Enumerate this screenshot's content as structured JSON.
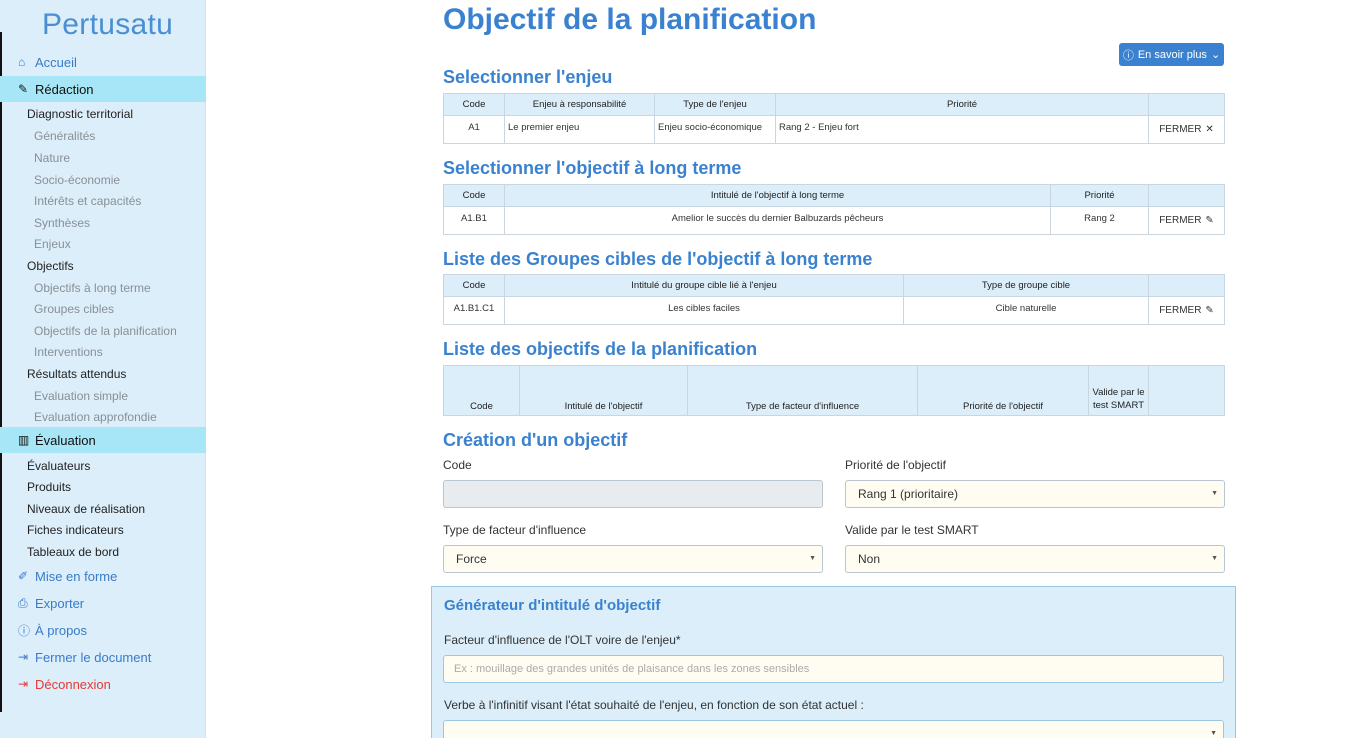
{
  "brand": "Pertusatu",
  "nav": {
    "accueil": "Accueil",
    "redaction": "Rédaction",
    "diagnostic": "Diagnostic territorial",
    "generalites": "Généralités",
    "nature": "Nature",
    "socio": "Socio-économie",
    "interets": "Intérêts et capacités",
    "syntheses": "Synthèses",
    "enjeux": "Enjeux",
    "objectifs": "Objectifs",
    "olt": "Objectifs à long terme",
    "groupes": "Groupes cibles",
    "obj_planif": "Objectifs de la planification",
    "interventions": "Interventions",
    "resultats": "Résultats attendus",
    "eval_simple": "Evaluation simple",
    "eval_appro": "Evaluation approfondie",
    "evaluation": "Évaluation",
    "evaluateurs": "Évaluateurs",
    "produits": "Produits",
    "niveaux": "Niveaux de réalisation",
    "fiches": "Fiches indicateurs",
    "tableaux": "Tableaux de bord",
    "mise_en_forme": "Mise en forme",
    "exporter": "Exporter",
    "apropos": "À propos",
    "fermer_doc": "Fermer le document",
    "deconnexion": "Déconnexion"
  },
  "page_title": "Objectif de la planification",
  "info_button": "En savoir plus",
  "sections": {
    "enjeu": "Selectionner l'enjeu",
    "olt": "Selectionner l'objectif à long terme",
    "groupes": "Liste des Groupes cibles de l'objectif à long terme",
    "objectifs": "Liste des objectifs de la planification",
    "creation": "Création d'un objectif"
  },
  "table_enjeu": {
    "headers": [
      "Code",
      "Enjeu à responsabilité",
      "Type de l'enjeu",
      "Priorité",
      ""
    ],
    "row": [
      "A1",
      "Le premier enjeu",
      "Enjeu socio-économique",
      "Rang 2 - Enjeu fort"
    ],
    "action": "FERMER"
  },
  "table_olt": {
    "headers": [
      "Code",
      "Intitulé de l'objectif à long terme",
      "Priorité",
      ""
    ],
    "row": [
      "A1.B1",
      "Amelior le succès du dernier Balbuzards pêcheurs",
      "Rang 2"
    ],
    "action": "FERMER"
  },
  "table_groupes": {
    "headers": [
      "Code",
      "Intitulé du groupe cible lié à l'enjeu",
      "Type de groupe cible",
      ""
    ],
    "row": [
      "A1.B1.C1",
      "Les cibles faciles",
      "Cible naturelle"
    ],
    "action": "FERMER"
  },
  "table_objectifs": {
    "headers": [
      "Code",
      "Intitulé de l'objectif",
      "Type de facteur d'influence",
      "Priorité de l'objectif",
      "Valide par le test SMART",
      ""
    ]
  },
  "form": {
    "code_label": "Code",
    "code_value": "",
    "priorite_label": "Priorité de l'objectif",
    "priorite_value": "Rang 1 (prioritaire)",
    "type_label": "Type de facteur d'influence",
    "type_value": "Force",
    "smart_label": "Valide par le test SMART",
    "smart_value": "Non"
  },
  "generator": {
    "title": "Générateur d'intitulé d'objectif",
    "facteur_label": "Facteur d'influence de l'OLT voire de l'enjeu*",
    "facteur_placeholder": "Ex : mouillage des grandes unités de plaisance dans les zones sensibles",
    "verbe_label": "Verbe à l'infinitif visant l'état souhaité de l'enjeu, en fonction de son état actuel :"
  }
}
